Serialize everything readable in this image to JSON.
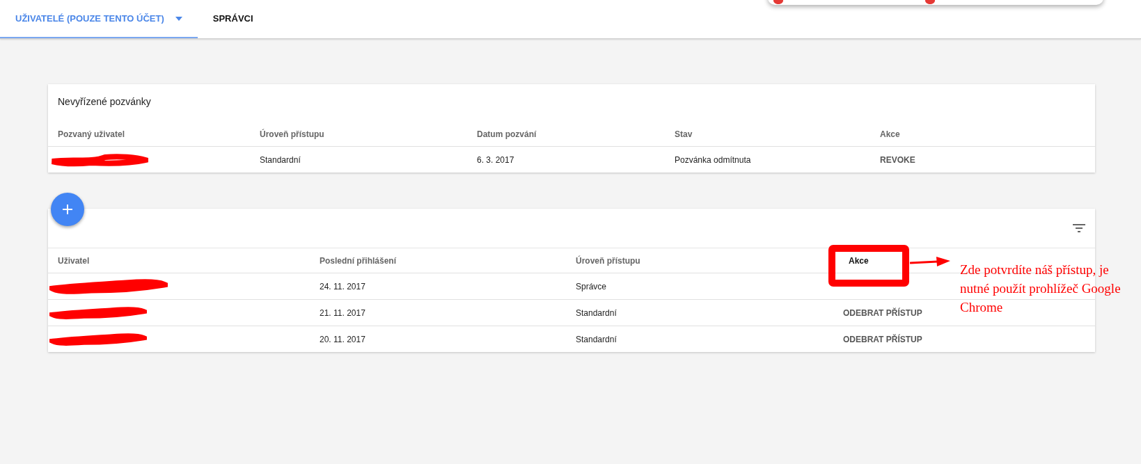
{
  "tabs": [
    {
      "label": "UŽIVATELÉ (POUZE TENTO ÚČET)",
      "selected": true,
      "has_dropdown": true
    },
    {
      "label": "SPRÁVCI",
      "selected": false,
      "has_dropdown": false
    }
  ],
  "invitations": {
    "title": "Nevyřízené pozvánky",
    "columns": [
      "Pozvaný uživatel",
      "Úroveň přístupu",
      "Datum pozvání",
      "Stav",
      "Akce"
    ],
    "rows": [
      {
        "user_redacted": true,
        "access": "Standardní",
        "date": "6. 3. 2017",
        "status": "Pozvánka odmítnuta",
        "action": "REVOKE"
      }
    ]
  },
  "users": {
    "columns": [
      "Uživatel",
      "Poslední přihlášení",
      "Úroveň přístupu",
      "Akce"
    ],
    "rows": [
      {
        "user_redacted": true,
        "last_login": "24. 11. 2017",
        "access": "Správce"
      },
      {
        "user_redacted": true,
        "last_login": "21. 11. 2017",
        "access": "Standardní",
        "action": "ODEBRAT PŘÍSTUP"
      },
      {
        "user_redacted": true,
        "last_login": "20. 11. 2017",
        "access": "Standardní",
        "action": "ODEBRAT PŘÍSTUP"
      }
    ]
  },
  "annotation": {
    "text": "Zde potvrdíte náš přístup, je nutné použít prohlížeč Google Chrome"
  }
}
